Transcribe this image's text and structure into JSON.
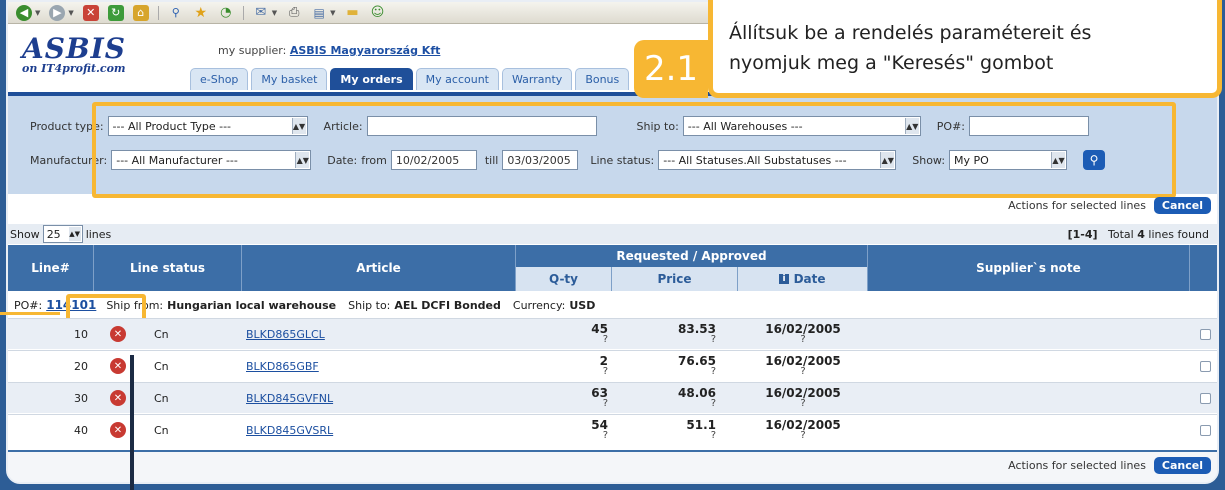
{
  "colors": {
    "accent": "#f7b733",
    "brand": "#1f4f99",
    "error": "#c83a32"
  },
  "toolbar": {
    "icons": [
      "back-icon",
      "forward-icon",
      "stop-icon",
      "refresh-icon",
      "home-icon",
      "search-icon",
      "favorites-icon",
      "history-icon",
      "mail-icon",
      "print-icon",
      "edit-icon",
      "folder-icon",
      "messenger-icon"
    ]
  },
  "header": {
    "logo_main": "ASBIS",
    "logo_sub": "on IT4profit.com",
    "supplier_label": "my supplier:",
    "supplier_name": "ASBIS Magyarország Kft",
    "tabs": [
      "e-Shop",
      "My basket",
      "My orders",
      "My account",
      "Warranty",
      "Bonus"
    ],
    "active_tab": "My orders"
  },
  "callout": {
    "number": "2.1",
    "line1": "Állítsuk be a rendelés paramétereit és",
    "line2": "nyomjuk meg a \"Keresés\" gombot"
  },
  "filter": {
    "product_type_label": "Product type:",
    "product_type_value": "--- All Product Type ---",
    "manufacturer_label": "Manufacturer:",
    "manufacturer_value": "--- All Manufacturer ---",
    "article_label": "Article:",
    "article_value": "",
    "date_label": "Date:",
    "date_from_label": "from",
    "date_from": "10/02/2005",
    "date_till_label": "till",
    "date_till": "03/03/2005",
    "ship_to_label": "Ship to:",
    "ship_to_value": "--- All Warehouses ---",
    "line_status_label": "Line status:",
    "line_status_value": "--- All Statuses.All Substatuses ---",
    "po_label": "PO#:",
    "po_value": "",
    "show_label": "Show:",
    "show_value": "My PO"
  },
  "actions": {
    "label": "Actions for selected lines",
    "cancel": "Cancel"
  },
  "pager": {
    "show_label": "Show",
    "show_value": "25",
    "lines_label": "lines",
    "range": "[1-4]",
    "total_prefix": "Total",
    "total_count": "4",
    "total_suffix": "lines found"
  },
  "table": {
    "headers": {
      "line": "Line#",
      "status": "Line status",
      "article": "Article",
      "group": "Requested / Approved",
      "qty": "Q-ty",
      "price": "Price",
      "date": "Date",
      "note": "Supplier`s note"
    },
    "po_prefix": "PO#:",
    "po_number": "114101",
    "ship_from_label": "Ship from:",
    "ship_from": "Hungarian local warehouse",
    "ship_to_label": "Ship to:",
    "ship_to": "AEL DCFI Bonded",
    "currency_label": "Currency:",
    "currency": "USD",
    "rows": [
      {
        "line": "10",
        "status": "Cn",
        "article": "BLKD865GLCL",
        "qty": "45",
        "qty_appr": "?",
        "price": "83.53",
        "price_appr": "?",
        "date": "16/02/2005",
        "date_appr": "?"
      },
      {
        "line": "20",
        "status": "Cn",
        "article": "BLKD865GBF",
        "qty": "2",
        "qty_appr": "?",
        "price": "76.65",
        "price_appr": "?",
        "date": "16/02/2005",
        "date_appr": "?"
      },
      {
        "line": "30",
        "status": "Cn",
        "article": "BLKD845GVFNL",
        "qty": "63",
        "qty_appr": "?",
        "price": "48.06",
        "price_appr": "?",
        "date": "16/02/2005",
        "date_appr": "?"
      },
      {
        "line": "40",
        "status": "Cn",
        "article": "BLKD845GVSRL",
        "qty": "54",
        "qty_appr": "?",
        "price": "51.1",
        "price_appr": "?",
        "date": "16/02/2005",
        "date_appr": "?"
      }
    ]
  }
}
